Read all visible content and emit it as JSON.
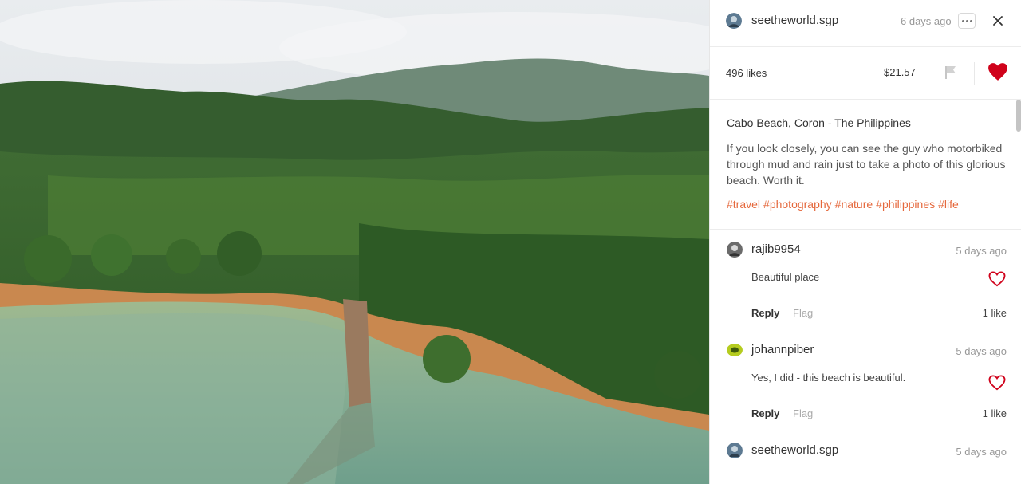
{
  "post": {
    "author": "seetheworld.sgp",
    "time": "6 days ago",
    "likes": "496 likes",
    "payout": "$21.57",
    "title": "Cabo Beach, Coron - The Philippines",
    "body": "If you look closely, you can see the guy who motorbiked through mud and rain just to take a photo of this glorious beach. Worth it.",
    "tags": [
      "#travel",
      "#photography",
      "#nature",
      "#philippines",
      "#life"
    ],
    "liked": true
  },
  "comments": [
    {
      "author": "rajib9954",
      "time": "5 days ago",
      "text": "Beautiful place",
      "reply": "Reply",
      "flag": "Flag",
      "likes": "1 like"
    },
    {
      "author": "johannpiber",
      "time": "5 days ago",
      "text": "Yes, I did - this beach is beautiful.",
      "reply": "Reply",
      "flag": "Flag",
      "likes": "1 like"
    },
    {
      "author": "seetheworld.sgp",
      "time": "5 days ago"
    }
  ],
  "colors": {
    "accent": "#e5683c",
    "heart": "#d0021b"
  },
  "icons": {
    "more": "more-icon",
    "close": "close-icon",
    "flag": "flag-icon",
    "heart": "heart-icon"
  }
}
